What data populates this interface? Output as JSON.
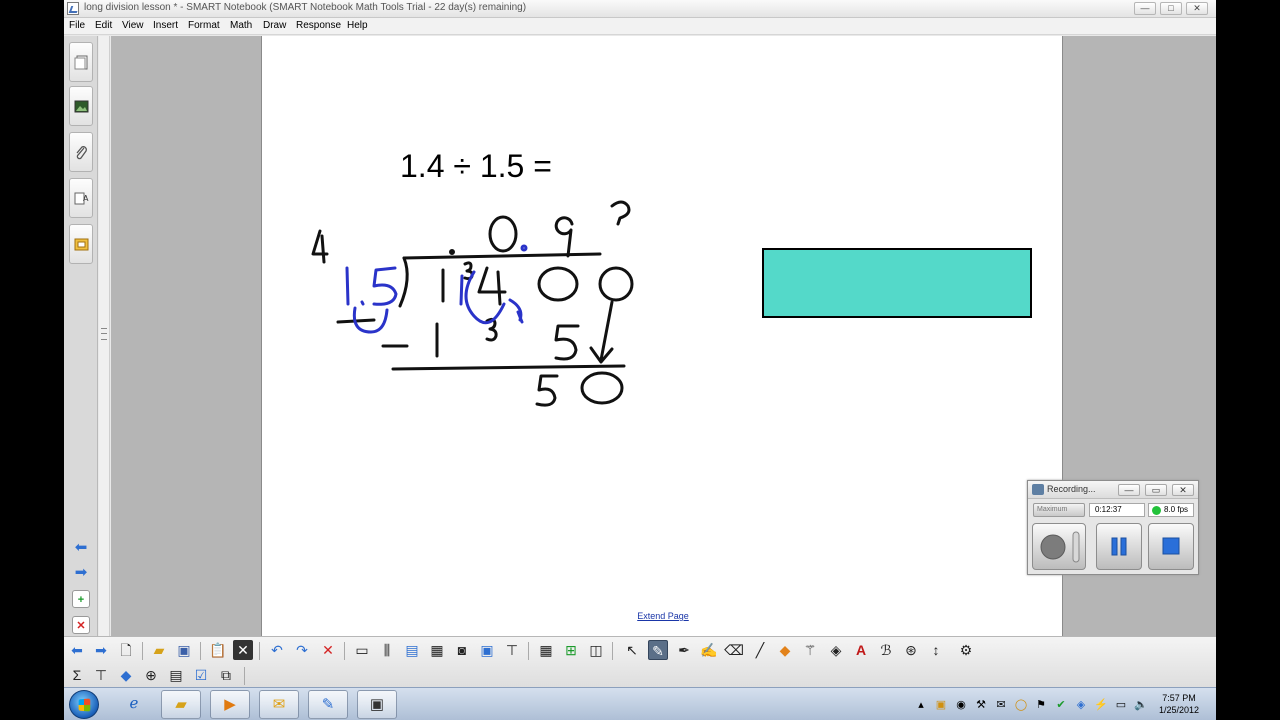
{
  "window": {
    "title": "long division lesson * - SMART Notebook (SMART Notebook Math Tools Trial - 22 day(s) remaining)",
    "minimize_glyph": "—",
    "maximize_glyph": "□",
    "close_glyph": "✕"
  },
  "menu": [
    "File",
    "Edit",
    "View",
    "Insert",
    "Format",
    "Math",
    "Draw",
    "Response",
    "Help"
  ],
  "sidebar": {
    "tabs": [
      "page-sorter-icon",
      "gallery-icon",
      "attachments-icon",
      "properties-icon",
      "addons-icon"
    ],
    "nav": [
      "back-arrow-icon",
      "forward-arrow-icon",
      "add-page-icon",
      "delete-page-icon"
    ]
  },
  "page": {
    "equation": "1.4 ÷ 1.5 =",
    "extend_label": "Extend Page",
    "rect_color": "#54d9c9"
  },
  "handwriting": {
    "quotient": "0.9",
    "divisor": "15",
    "dividend": "14.00",
    "carry_top": "3",
    "carry_mid": "3",
    "subtract_line": "- 1 3 5",
    "remainder": "50",
    "margin_digit": "4",
    "question_mark": "?"
  },
  "recorder": {
    "title": "Recording...",
    "mode": "Maximum",
    "elapsed": "0:12:37",
    "fps": "8.0 fps",
    "status_color": "#22c23a"
  },
  "toolbar": {
    "row1": [
      "previous-page-icon",
      "next-page-icon",
      "blank-page-icon",
      "open-file-icon",
      "save-icon",
      "paste-icon",
      "delete-icon",
      "undo-icon",
      "redo-icon",
      "clear-page-icon",
      "screen-shade-icon",
      "full-screen-icon",
      "show-screen-icon",
      "capture-icon",
      "camera-icon",
      "document-camera-icon",
      "table-icon",
      "response-icon",
      "measure-icon",
      "select-icon",
      "pen-icon",
      "creative-pen-icon",
      "magic-pen-icon",
      "eraser-icon",
      "line-icon",
      "shapes-icon",
      "magic-wand-icon",
      "fill-icon",
      "text-icon",
      "handwriting-icon",
      "properties-tool-icon",
      "move-toolbar-icon",
      "customize-icon"
    ],
    "row2": [
      "sigma-icon",
      "math-tools-icon",
      "shapes-recognition-icon",
      "geometry-icon",
      "table-tool-icon",
      "checklist-icon",
      "add-ons-icon"
    ]
  },
  "taskbar": {
    "apps": [
      "explorer-folder-icon",
      "internet-explorer-icon",
      "media-player-icon",
      "outlook-icon",
      "smart-notebook-icon",
      "recorder-icon"
    ],
    "time": "7:57 PM",
    "date": "1/25/2012"
  }
}
